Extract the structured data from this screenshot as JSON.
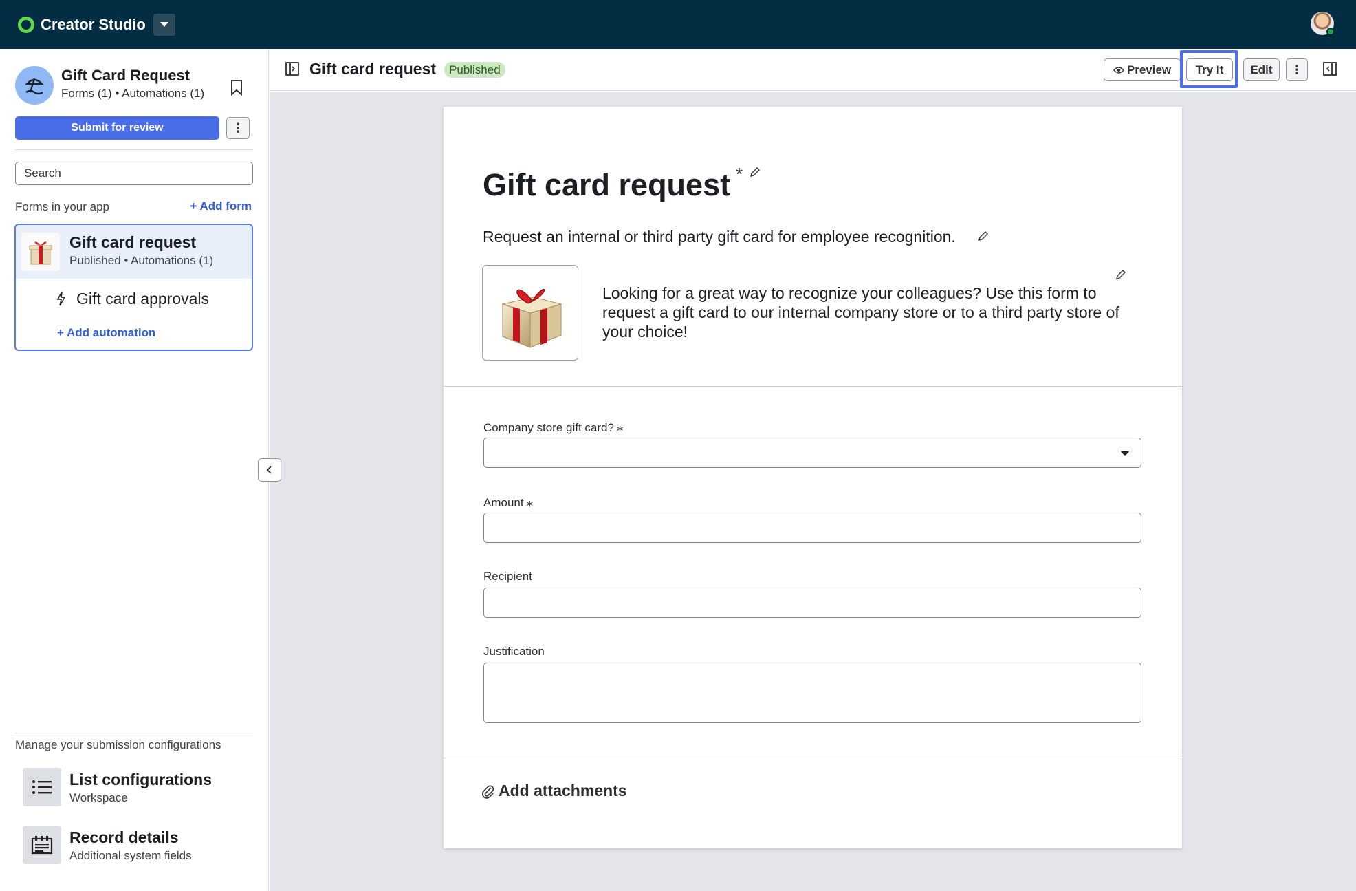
{
  "topbar": {
    "brand_name": "Creator Studio",
    "logo_icon": "ring-logo-icon",
    "dropdown_icon": "caret-down-icon",
    "avatar_icon": "user-avatar-icon"
  },
  "sidebar": {
    "app_title": "Gift Card Request",
    "app_subtitle": "Forms (1) • Automations (1)",
    "submit_label": "Submit for review",
    "kebab_label": "⋮",
    "search_placeholder": "Search",
    "forms_label": "Forms in your app",
    "add_form_label": "+ Add form",
    "form": {
      "name": "Gift card request",
      "meta": "Published • Automations (1)",
      "automation_name": "Gift card approvals",
      "add_automation_label": "+ Add automation"
    },
    "manage_label": "Manage your submission configurations",
    "configs": [
      {
        "title": "List configurations",
        "subtitle": "Workspace",
        "icon": "list-icon"
      },
      {
        "title": "Record details",
        "subtitle": "Additional system fields",
        "icon": "record-details-icon"
      }
    ]
  },
  "header": {
    "title": "Gift card request",
    "status_badge": "Published",
    "preview_label": "Preview",
    "tryit_label": "Try It",
    "edit_label": "Edit",
    "more_label": "⋮"
  },
  "form_sheet": {
    "title": "Gift card request",
    "title_marker": "*",
    "description": "Request an internal or third party gift card for employee recognition.",
    "hero_text": "Looking for a great way to recognize your colleagues? Use this form to request a gift card to our internal company store or to a third party store of your choice!",
    "fields": [
      {
        "label": "Company store gift card?",
        "required": true,
        "type": "select"
      },
      {
        "label": "Amount",
        "required": true,
        "type": "text"
      },
      {
        "label": "Recipient",
        "required": false,
        "type": "text"
      },
      {
        "label": "Justification",
        "required": false,
        "type": "textarea"
      }
    ],
    "required_marker": "⁎",
    "attach_label": "Add attachments"
  },
  "colors": {
    "topbar_bg": "#032d42",
    "accent": "#4a6ee8",
    "brand_ring": "#62d84e",
    "published_badge_bg": "#cfe8c4"
  }
}
